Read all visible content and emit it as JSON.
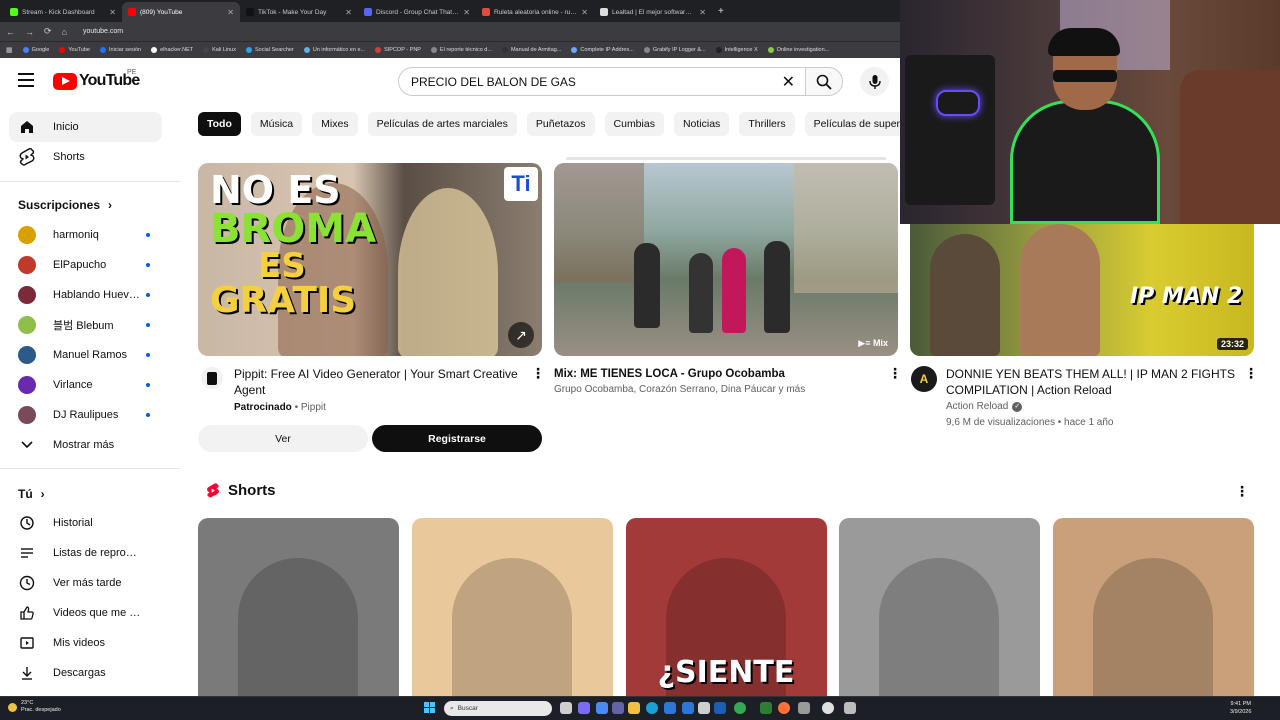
{
  "browser": {
    "tabs": [
      {
        "label": "Stream - Kick Dashboard",
        "color": "#53fc18"
      },
      {
        "label": "(809) YouTube",
        "color": "#ff0000",
        "active": true
      },
      {
        "label": "TikTok - Make Your Day",
        "color": "#111111"
      },
      {
        "label": "Discord - Group Chat That's All",
        "color": "#5865f2"
      },
      {
        "label": "Ruleta aleatoria online - ruleta",
        "color": "#e44b3f"
      },
      {
        "label": "Lealtad | El mejor software para",
        "color": "#dddddd"
      }
    ],
    "new_tab": "+",
    "url": "youtube.com",
    "bookmarks": [
      {
        "label": "Google",
        "color": "#4285f4"
      },
      {
        "label": "YouTube",
        "color": "#ff0000"
      },
      {
        "label": "Iniciar sesión",
        "color": "#1877f2"
      },
      {
        "label": "elhacker.NET",
        "color": "#ffffff"
      },
      {
        "label": "Kali Linux",
        "color": "#444444"
      },
      {
        "label": "Social Searcher",
        "color": "#2aa3ef"
      },
      {
        "label": "Un informático en e...",
        "color": "#5ab4e6"
      },
      {
        "label": "SIPCOP - PNP",
        "color": "#d33f3f"
      },
      {
        "label": "El reporte técnico d...",
        "color": "#888888"
      },
      {
        "label": "Manual de Armitag...",
        "color": "#333333"
      },
      {
        "label": "Complete IP Addres...",
        "color": "#66aaff"
      },
      {
        "label": "Grabify IP Logger &...",
        "color": "#888888"
      },
      {
        "label": "Intelligence X",
        "color": "#222222"
      },
      {
        "label": "Online investigation...",
        "color": "#88cc44"
      }
    ]
  },
  "header": {
    "logo_text": "YouTube",
    "country_code": "PE",
    "search_value": "PRECIO DEL BALON DE GAS"
  },
  "sidebar": {
    "main": [
      {
        "label": "Inicio",
        "icon": "home-icon",
        "active": true
      },
      {
        "label": "Shorts",
        "icon": "shorts-icon"
      }
    ],
    "subscriptions_title": "Suscripciones",
    "subscriptions": [
      {
        "label": "harmoniq",
        "color": "#d9a100"
      },
      {
        "label": "ElPapucho",
        "color": "#c0392b"
      },
      {
        "label": "Hablando Huevadas",
        "color": "#7b2a3a"
      },
      {
        "label": "블범 Blebum",
        "color": "#8fbf4a"
      },
      {
        "label": "Manuel Ramos",
        "color": "#2c5b8a"
      },
      {
        "label": "Virlance",
        "color": "#6a2ab0"
      },
      {
        "label": "DJ Raulipues",
        "color": "#7a4a5a"
      }
    ],
    "show_more": "Mostrar más",
    "you_title": "Tú",
    "you": [
      {
        "label": "Historial",
        "icon": "history-icon"
      },
      {
        "label": "Listas de reproducción",
        "icon": "playlists-icon"
      },
      {
        "label": "Ver más tarde",
        "icon": "watch-later-icon"
      },
      {
        "label": "Videos que me gustan",
        "icon": "like-icon"
      },
      {
        "label": "Mis videos",
        "icon": "my-videos-icon"
      },
      {
        "label": "Descargas",
        "icon": "downloads-icon"
      }
    ]
  },
  "chips": [
    "Todo",
    "Música",
    "Mixes",
    "Películas de artes marciales",
    "Puñetazos",
    "Cumbias",
    "Noticias",
    "Thrillers",
    "Películas de superhéroes"
  ],
  "videos": {
    "ad": {
      "thumb_lines": [
        "NO ES",
        "BROMA",
        "ES",
        "GRATIS"
      ],
      "title": "Pippit: Free AI Video Generator | Your Smart Creative Agent",
      "sponsored": "Patrocinado",
      "advertiser": "Pippit",
      "btn_view": "Ver",
      "btn_signup": "Registrarse"
    },
    "mix": {
      "title": "Mix: ME TIENES LOCA - Grupo Ocobamba",
      "channels": "Grupo Ocobamba, Corazón Serrano, Dina Páucar y más",
      "badge": "Mix"
    },
    "ipman": {
      "thumb_text": "IP MAN 2",
      "duration": "23:32",
      "title": "DONNIE YEN BEATS THEM ALL! | IP MAN 2 FIGHTS COMPILATION | Action Reload",
      "channel": "Action Reload",
      "stats": "9,6 M de visualizaciones • hace 1 año"
    }
  },
  "shorts": {
    "title": "Shorts",
    "items": [
      {
        "bg": "#7a7a7a"
      },
      {
        "bg": "#e9c99b"
      },
      {
        "bg": "#a33a3a",
        "caption": "¿SIENTE"
      },
      {
        "bg": "#9a9a9a"
      },
      {
        "bg": "#c9a07a"
      }
    ]
  },
  "taskbar": {
    "temp": "23°C",
    "weather": "Prac. despejado",
    "search_placeholder": "Buscar",
    "time": "9:41 PM",
    "date": "3/9/2026"
  }
}
